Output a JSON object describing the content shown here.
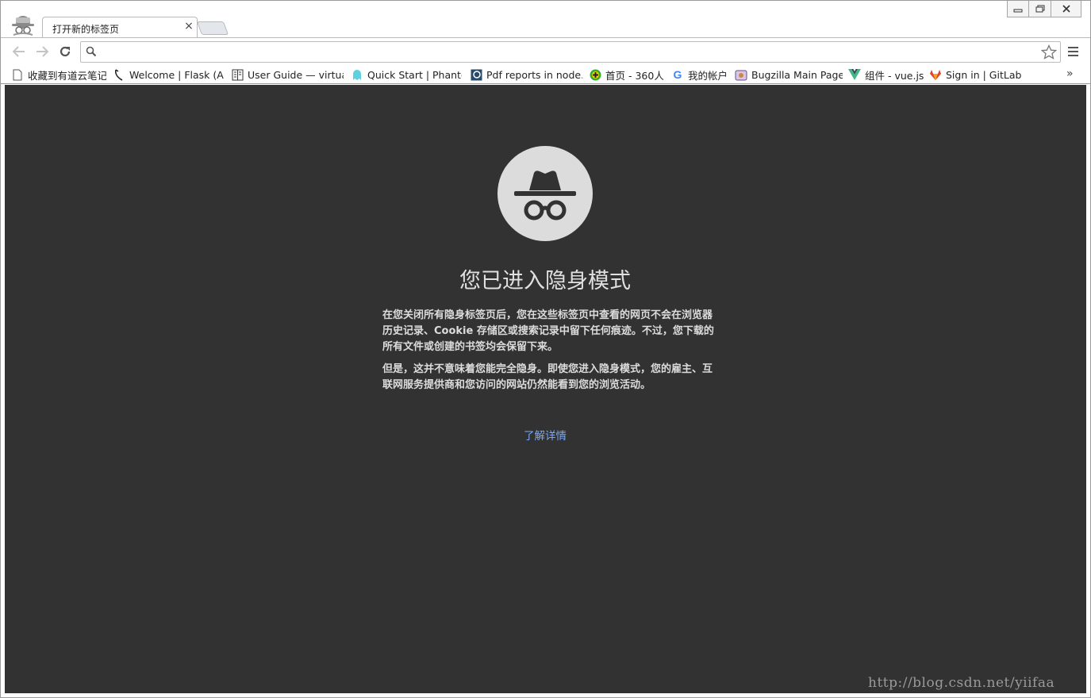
{
  "tab": {
    "title": "打开新的标签页",
    "close": "×"
  },
  "window_controls": {
    "minimize": "▭",
    "restore": "⧉",
    "close": "✕"
  },
  "omnibox": {
    "value": "",
    "placeholder": ""
  },
  "bookmarks": [
    {
      "label": "收藏到有道云笔记",
      "icon": "page-icon"
    },
    {
      "label": "Welcome | Flask (A",
      "icon": "flask-icon"
    },
    {
      "label": "User Guide — virtua",
      "icon": "book-icon"
    },
    {
      "label": "Quick Start | Phanto",
      "icon": "ghost-icon"
    },
    {
      "label": "Pdf reports in node.j",
      "icon": "pdf-icon"
    },
    {
      "label": "首页 - 360人",
      "icon": "plus-icon"
    },
    {
      "label": "我的帐户",
      "icon": "google-icon"
    },
    {
      "label": "Bugzilla Main Page",
      "icon": "bug-icon"
    },
    {
      "label": "组件 - vue.js",
      "icon": "vue-icon"
    },
    {
      "label": "Sign in | GitLab",
      "icon": "gitlab-icon"
    }
  ],
  "bookmarks_more": "»",
  "content": {
    "heading": "您已进入隐身模式",
    "paragraph1": "在您关闭所有隐身标签页后，您在这些标签页中查看的网页不会在浏览器历史记录、Cookie 存储区或搜索记录中留下任何痕迹。不过，您下载的所有文件或创建的书签均会保留下来。",
    "paragraph2": "但是，这并不意味着您能完全隐身。即使您进入隐身模式，您的雇主、互联网服务提供商和您访问的网站仍然能看到您的浏览活动。",
    "learn_more": "了解详情"
  },
  "watermark": "http://blog.csdn.net/yiifaa",
  "colors": {
    "content_bg": "#323232",
    "link": "#7baaf7",
    "icon_circle": "#dcdcdc"
  }
}
